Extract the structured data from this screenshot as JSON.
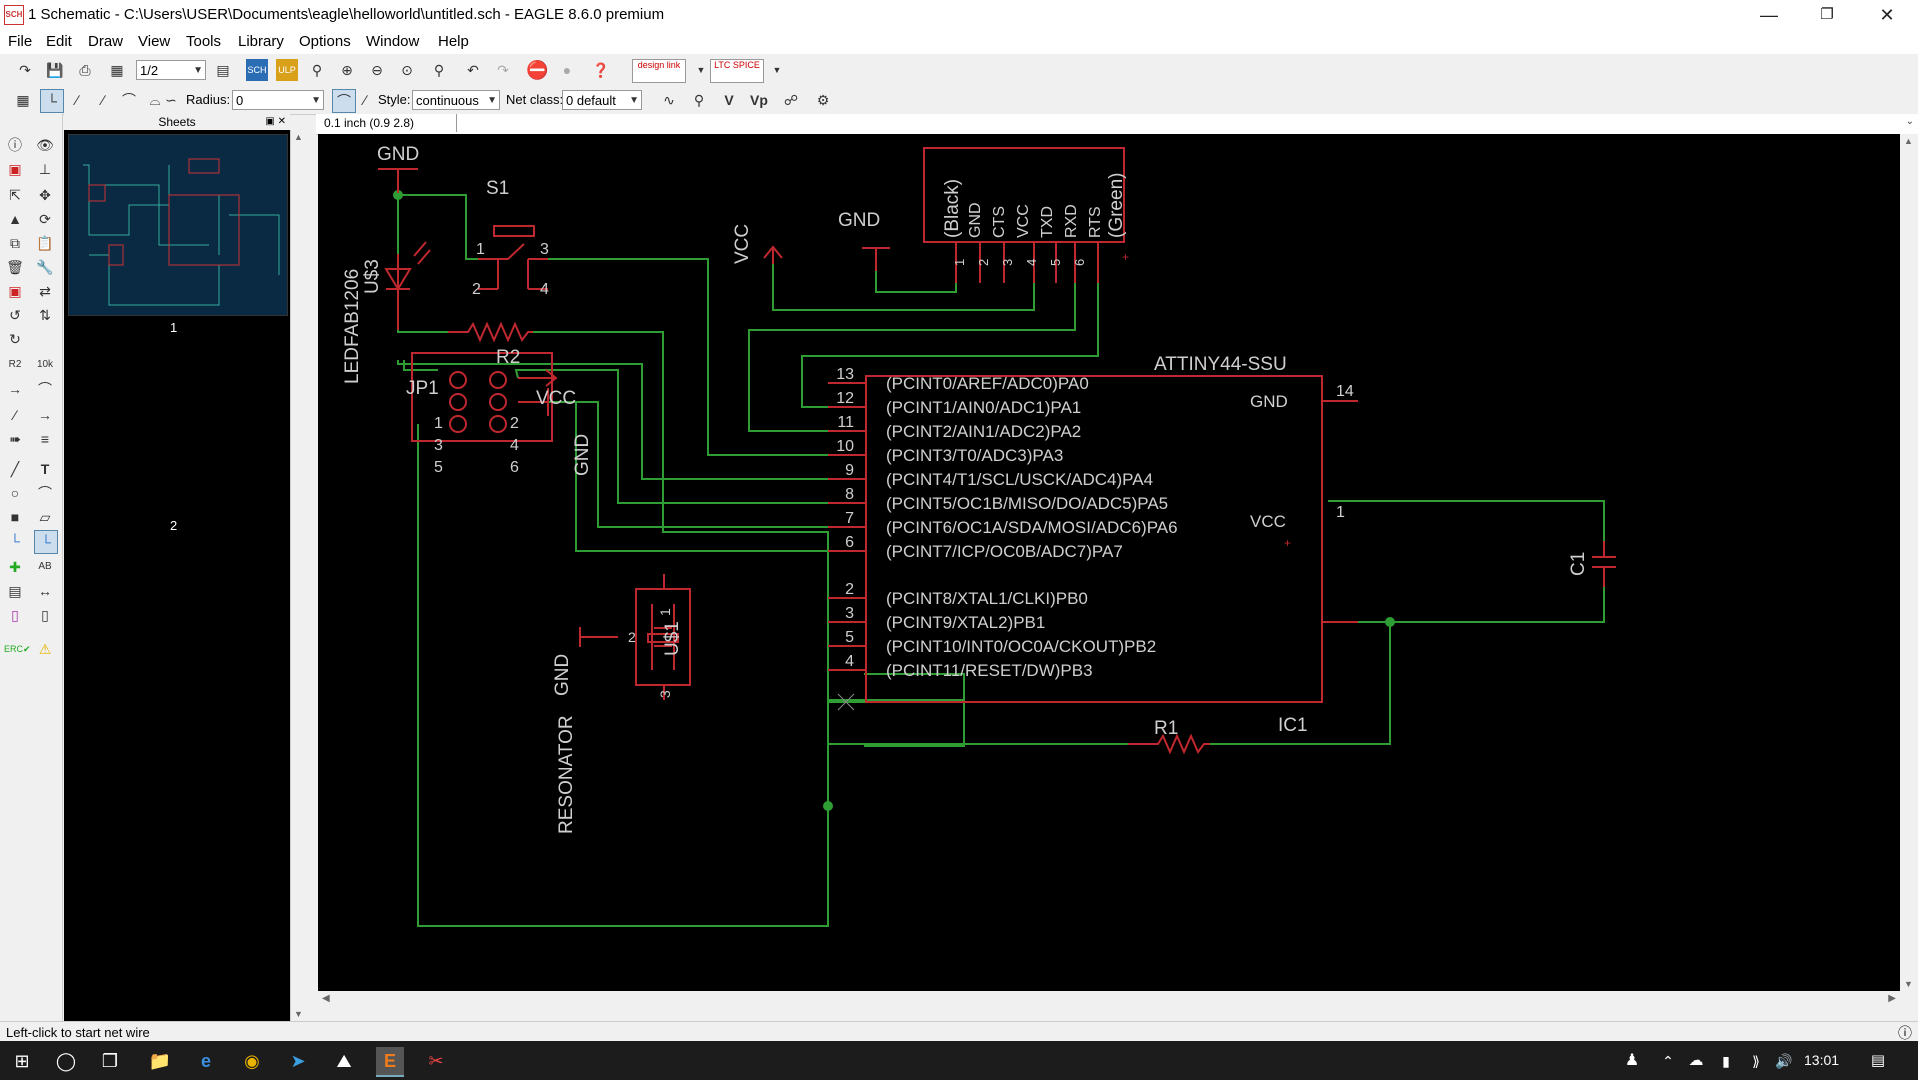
{
  "window": {
    "title": "1 Schematic - C:\\Users\\USER\\Documents\\eagle\\helloworld\\untitled.sch - EAGLE 8.6.0 premium",
    "app_icon": "SCH"
  },
  "menu": [
    "File",
    "Edit",
    "Draw",
    "View",
    "Tools",
    "Library",
    "Options",
    "Window",
    "Help"
  ],
  "toolbar": {
    "sheet_select": "1/2",
    "radius_label": "Radius:",
    "radius_value": "0",
    "style_label": "Style:",
    "style_value": "continuous",
    "netclass_label": "Net class:",
    "netclass_value": "0 default",
    "designlink_label": "design link",
    "spice_label": "LTC SPICE"
  },
  "sheets_panel": {
    "header": "Sheets",
    "sheet1": "1",
    "sheet2": "2"
  },
  "coord_readout": "0.1 inch (0.9 2.8)",
  "status_text": "Left-click to start net wire",
  "taskbar": {
    "time": "13:01"
  },
  "schematic": {
    "gnd_top": "GND",
    "s1": "S1",
    "s1_pins": [
      "1",
      "2",
      "3",
      "4"
    ],
    "led_name": "U$3",
    "led_value": "LEDFAB1206",
    "r2": "R2",
    "vcc_ftdi": "VCC",
    "gnd_ftdi": "GND",
    "ftdi_pins": [
      "(Black)",
      "GND",
      "CTS",
      "VCC",
      "TXD",
      "RXD",
      "RTS",
      "(Green)"
    ],
    "ftdi_pin_numbers": [
      "1",
      "2",
      "3",
      "4",
      "5",
      "6"
    ],
    "jp1": "JP1",
    "jp1_vcc": "VCC",
    "jp1_gnd": "GND",
    "jp1_pins": [
      "1",
      "2",
      "3",
      "4",
      "5",
      "6"
    ],
    "ic_value": "ATTINY44-SSU",
    "ic_name": "IC1",
    "ic_gnd": "GND",
    "ic_vcc": "VCC",
    "ic_gnd_pin": "14",
    "ic_vcc_pin": "1",
    "ic_left_pins": [
      {
        "num": "13",
        "name": "(PCINT0/AREF/ADC0)PA0"
      },
      {
        "num": "12",
        "name": "(PCINT1/AIN0/ADC1)PA1"
      },
      {
        "num": "11",
        "name": "(PCINT2/AIN1/ADC2)PA2"
      },
      {
        "num": "10",
        "name": "(PCINT3/T0/ADC3)PA3"
      },
      {
        "num": "9",
        "name": "(PCINT4/T1/SCL/USCK/ADC4)PA4"
      },
      {
        "num": "8",
        "name": "(PCINT5/OC1B/MISO/DO/ADC5)PA5"
      },
      {
        "num": "7",
        "name": "(PCINT6/OC1A/SDA/MOSI/ADC6)PA6"
      },
      {
        "num": "6",
        "name": "(PCINT7/ICP/OC0B/ADC7)PA7"
      },
      {
        "num": "2",
        "name": "(PCINT8/XTAL1/CLKI)PB0"
      },
      {
        "num": "3",
        "name": "(PCINT9/XTAL2)PB1"
      },
      {
        "num": "5",
        "name": "(PCINT10/INT0/OC0A/CKOUT)PB2"
      },
      {
        "num": "4",
        "name": "(PCINT11/RESET/DW)PB3"
      }
    ],
    "c1": "C1",
    "r1": "R1",
    "res_name": "U$1",
    "res_value": "RESONATOR",
    "res_gnd": "GND",
    "res_pins": [
      "1",
      "2",
      "3"
    ]
  }
}
